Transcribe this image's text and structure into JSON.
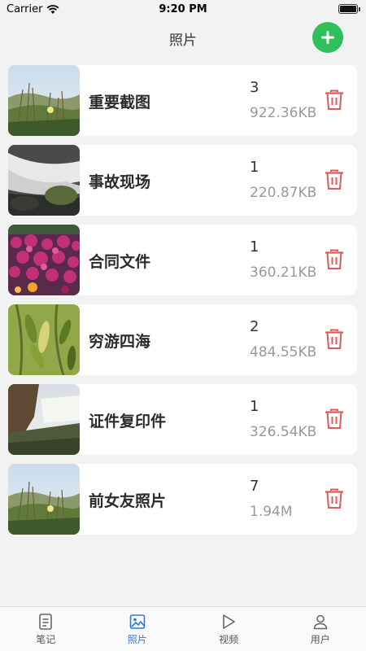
{
  "status_bar": {
    "carrier": "Carrier",
    "time": "9:20 PM"
  },
  "header": {
    "title": "照片"
  },
  "albums": [
    {
      "name": "重要截图",
      "count": "3",
      "size": "922.36KB"
    },
    {
      "name": "事故现场",
      "count": "1",
      "size": "220.87KB"
    },
    {
      "name": "合同文件",
      "count": "1",
      "size": "360.21KB"
    },
    {
      "name": "穷游四海",
      "count": "2",
      "size": "484.55KB"
    },
    {
      "name": "证件复印件",
      "count": "1",
      "size": "326.54KB"
    },
    {
      "name": "前女友照片",
      "count": "7",
      "size": "1.94M"
    }
  ],
  "tabs": [
    {
      "label": "笔记",
      "icon": "notes-icon",
      "active": false
    },
    {
      "label": "照片",
      "icon": "photo-icon",
      "active": true
    },
    {
      "label": "视频",
      "icon": "play-icon",
      "active": false
    },
    {
      "label": "用户",
      "icon": "user-icon",
      "active": false
    }
  ],
  "colors": {
    "accent_green": "#2fbf5b",
    "delete_red": "#e05a5a",
    "active_tab": "#2a7ad6"
  }
}
